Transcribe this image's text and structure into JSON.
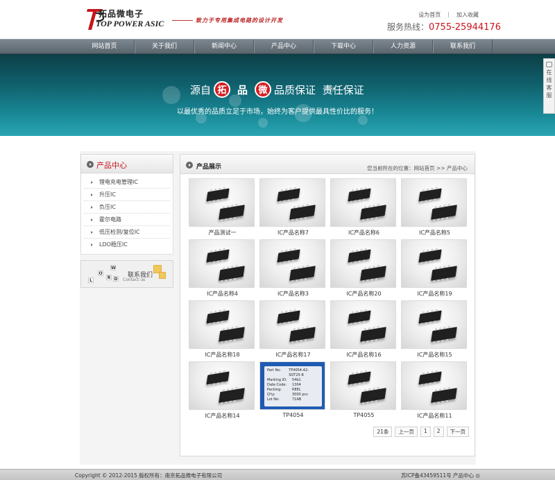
{
  "header": {
    "logo_cn": "拓品微电子",
    "logo_en": "TOP POWER ASIC",
    "slogan": "致力于专用集成电路的设计开发",
    "links": [
      "设为首页",
      "加入收藏"
    ],
    "hotline_label": "服务热线：",
    "hotline_number": "0755-25944176"
  },
  "nav": {
    "items": [
      "网站首页",
      "关于我们",
      "新闻中心",
      "产品中心",
      "下载中心",
      "人力资源",
      "联系我们"
    ]
  },
  "banner": {
    "title_prefix": "源自",
    "badge_1": "拓",
    "middle": "品",
    "badge_2": "微",
    "title_suffix": "品质保证  责任保证",
    "subtitle": "以最优秀的品质立足于市场，始终为客户提供最具性价比的服务！"
  },
  "side_service": [
    "在",
    "线",
    "客",
    "服"
  ],
  "left": {
    "heading": "产品中心",
    "items": [
      "锂电充电管理IC",
      "升压IC",
      "负压IC",
      "霍尔电路",
      "低压检测/复位IC",
      "LDO稳压IC"
    ],
    "contact_cn": "联系我们",
    "contact_en": "Contact us",
    "contact_cubes": [
      "W",
      "O",
      "R",
      "L",
      "D"
    ]
  },
  "right": {
    "heading": "产品展示",
    "breadcrumb": "您当前所在的位置：网站首页 >> 产品中心",
    "products": [
      "产品测试一",
      "IC产品名称7",
      "IC产品名称6",
      "IC产品名称5",
      "IC产品名称4",
      "IC产品名称3",
      "IC产品名称20",
      "IC产品名称19",
      "IC产品名称18",
      "IC产品名称17",
      "IC产品名称16",
      "IC产品名称15",
      "IC产品名称14",
      "TP4054",
      "TP4055",
      "IC产品名称11"
    ],
    "label_sticker": [
      [
        "Part No:",
        "TP4054-42-SOT25-R"
      ],
      [
        "Marking ID:",
        "54b1"
      ],
      [
        "Date Code:",
        "1304"
      ],
      [
        "Packing:",
        "REEL"
      ],
      [
        "Q'ty:",
        "3000 pcs"
      ],
      [
        "Lot No:",
        "71AB"
      ]
    ],
    "pager": [
      "21条",
      "上一页",
      "1",
      "2",
      "下一页"
    ]
  },
  "footer": {
    "left": "Copyright © 2012-2015 版权所有：南京拓品微电子有限公司",
    "right": "苏ICP备43459511号 产品中心 ◎"
  },
  "colors": {
    "accent_red": "#c8141b",
    "nav_bg": "#6b747d",
    "banner_teal": "#1a8a98"
  }
}
